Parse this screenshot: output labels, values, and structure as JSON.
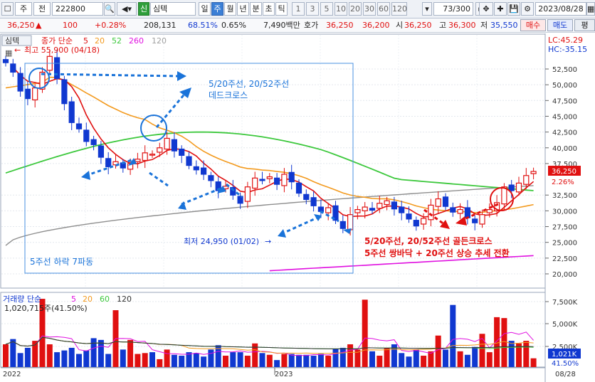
{
  "toolbar": {
    "market_type": "주",
    "view_type": "전",
    "stock_code": "222800",
    "credit_badge": "신",
    "stock_name": "심텍",
    "periods": [
      "일",
      "주",
      "월",
      "년",
      "분",
      "초",
      "틱"
    ],
    "active_period": "주",
    "intervals": [
      "1",
      "3",
      "5",
      "10",
      "20",
      "30",
      "60",
      "120"
    ],
    "count": "73/300",
    "date": "2023/08/28"
  },
  "quote": {
    "price": "36,250",
    "change": "100",
    "change_pct": "+0.28%",
    "volume": "208,131",
    "volume_ratio": "68.51%",
    "turnover_rate": "0.65%",
    "amount": "7,490백만",
    "ask_label": "호가",
    "ask_price": "36,250",
    "bid_price": "36,200",
    "open_label": "시",
    "open": "36,250",
    "high_label": "고",
    "high": "36,300",
    "low_label": "저",
    "low": "35,550",
    "buy_label": "매수",
    "sell_label": "매도",
    "eval_label": "평"
  },
  "price_panel": {
    "stock_tab": "심텍",
    "legend_prefix": "종가 단순",
    "ma_periods": [
      "5",
      "20",
      "52",
      "260",
      "120"
    ],
    "ma_colors": [
      "#e01010",
      "#f39a1e",
      "#3cc83c",
      "#e010e0",
      "#a0a0a0"
    ],
    "high_label": "최고 55,900 (04/18)",
    "low_label": "최저 24,950 (01/02)",
    "lc_label": "LC:45.29",
    "hc_label": "HC:-35.15",
    "current_price_tag": "36,250",
    "change_pct_tag": "2.26%",
    "y_ticks": [
      "52,500",
      "50,000",
      "47,500",
      "45,000",
      "42,500",
      "40,000",
      "37,500",
      "32,500",
      "30,000",
      "27,500",
      "25,000",
      "22,500",
      "20,000"
    ]
  },
  "annotations": {
    "dead_cross": "5/20주선, 20/52주선\n데드크로스",
    "downtrend": "5주선 하락 7파동",
    "golden_cross_1": "5/20주선, 20/52주선 골든크로스",
    "golden_cross_2": "5주선 쌍바닥 + 20주선 상승 추세 전환",
    "colors": {
      "blue": "#1a73d9",
      "red": "#e01010"
    }
  },
  "volume_panel": {
    "legend_prefix": "거래량 단순",
    "ma_periods": [
      "5",
      "20",
      "60",
      "120"
    ],
    "volume_label": "1,020,715주(41.50%)",
    "y_ticks": [
      "7,500K",
      "5,000K",
      "2,500K"
    ],
    "current_tag": "1,021K",
    "pct_tag": "41.50%"
  },
  "x_axis": {
    "labels": [
      "2022",
      "2023"
    ],
    "last_date": "08/28"
  }
}
